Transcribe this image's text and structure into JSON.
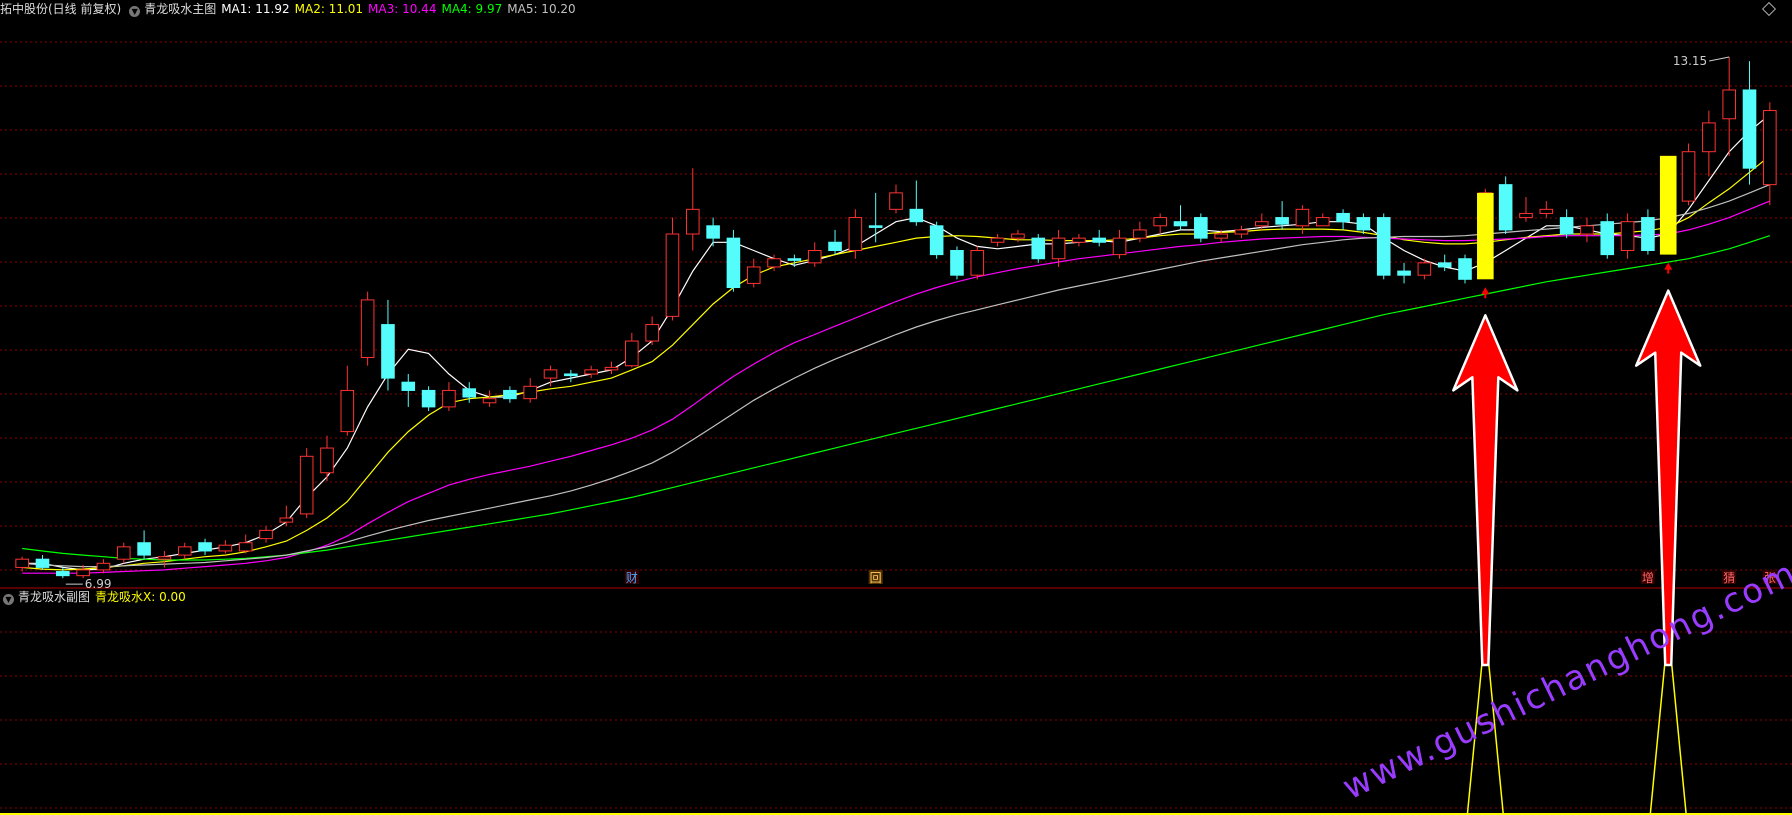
{
  "header": {
    "stock": "拓中股份(日线 前复权)",
    "indicator": "青龙吸水主图",
    "ma": [
      {
        "label": "MA1: 11.92",
        "color": "#ffffff"
      },
      {
        "label": "MA2: 11.01",
        "color": "#ffff00"
      },
      {
        "label": "MA3: 10.44",
        "color": "#ff00ff"
      },
      {
        "label": "MA4: 9.97",
        "color": "#00ff00"
      },
      {
        "label": "MA5: 10.20",
        "color": "#c0c0c0"
      }
    ]
  },
  "sub_header": {
    "indicator": "青龙吸水副图",
    "value_label": "青龙吸水X: 0.00"
  },
  "markers": [
    "财",
    "回",
    "增",
    "猜",
    "张"
  ],
  "watermark": "www.gushichanghong.com",
  "colors": {
    "up": "#ff3232",
    "down": "#54fcfc",
    "signal": "#ffff00",
    "grid": "#8a0000",
    "arrow": "#ff0000"
  },
  "chart_data": {
    "type": "candlestick",
    "y_max_label": "13.15",
    "y_min_label": "6.99",
    "ylim": [
      6.7,
      13.6
    ],
    "candles": [
      [
        6.95,
        7.05,
        7.08,
        6.9
      ],
      [
        7.05,
        6.95,
        7.1,
        6.92
      ],
      [
        6.9,
        6.85,
        6.95,
        6.82
      ],
      [
        6.85,
        6.92,
        6.98,
        6.82
      ],
      [
        6.92,
        7.0,
        7.05,
        6.88
      ],
      [
        7.05,
        7.2,
        7.25,
        7.0
      ],
      [
        7.25,
        7.1,
        7.4,
        7.05
      ],
      [
        7.05,
        7.08,
        7.15,
        6.95
      ],
      [
        7.1,
        7.2,
        7.25,
        7.05
      ],
      [
        7.25,
        7.15,
        7.3,
        7.1
      ],
      [
        7.15,
        7.22,
        7.28,
        7.12
      ],
      [
        7.15,
        7.25,
        7.35,
        7.12
      ],
      [
        7.3,
        7.4,
        7.45,
        7.25
      ],
      [
        7.5,
        7.55,
        7.7,
        7.45
      ],
      [
        7.6,
        8.3,
        8.4,
        7.55
      ],
      [
        8.1,
        8.4,
        8.55,
        8.0
      ],
      [
        8.6,
        9.1,
        9.4,
        8.55
      ],
      [
        9.5,
        10.2,
        10.3,
        9.4
      ],
      [
        9.9,
        9.25,
        10.2,
        9.1
      ],
      [
        9.2,
        9.1,
        9.3,
        8.9
      ],
      [
        9.1,
        8.9,
        9.15,
        8.85
      ],
      [
        8.9,
        9.1,
        9.2,
        8.85
      ],
      [
        9.12,
        9.02,
        9.2,
        8.95
      ],
      [
        8.95,
        9.0,
        9.1,
        8.9
      ],
      [
        9.1,
        9.0,
        9.15,
        8.95
      ],
      [
        9.0,
        9.15,
        9.25,
        8.95
      ],
      [
        9.25,
        9.35,
        9.4,
        9.15
      ],
      [
        9.3,
        9.28,
        9.35,
        9.2
      ],
      [
        9.3,
        9.35,
        9.4,
        9.25
      ],
      [
        9.35,
        9.38,
        9.45,
        9.3
      ],
      [
        9.4,
        9.7,
        9.8,
        9.38
      ],
      [
        9.7,
        9.9,
        10.0,
        9.65
      ],
      [
        10.0,
        11.0,
        11.2,
        9.95
      ],
      [
        11.0,
        11.3,
        11.8,
        10.8
      ],
      [
        11.1,
        10.95,
        11.2,
        10.85
      ],
      [
        10.95,
        10.35,
        11.05,
        10.3
      ],
      [
        10.4,
        10.6,
        10.7,
        10.35
      ],
      [
        10.6,
        10.7,
        10.75,
        10.55
      ],
      [
        10.7,
        10.68,
        10.75,
        10.6
      ],
      [
        10.65,
        10.8,
        10.9,
        10.6
      ],
      [
        10.9,
        10.8,
        11.05,
        10.75
      ],
      [
        10.8,
        11.2,
        11.3,
        10.7
      ],
      [
        11.1,
        11.08,
        11.5,
        10.9
      ],
      [
        11.3,
        11.5,
        11.6,
        11.25
      ],
      [
        11.3,
        11.15,
        11.65,
        11.1
      ],
      [
        11.1,
        10.75,
        11.15,
        10.7
      ],
      [
        10.8,
        10.5,
        10.85,
        10.45
      ],
      [
        10.5,
        10.8,
        10.85,
        10.45
      ],
      [
        10.9,
        10.95,
        11.0,
        10.85
      ],
      [
        10.95,
        11.0,
        11.05,
        10.9
      ],
      [
        10.95,
        10.7,
        11.0,
        10.65
      ],
      [
        10.7,
        10.95,
        11.05,
        10.6
      ],
      [
        10.9,
        10.95,
        11.0,
        10.85
      ],
      [
        10.95,
        10.9,
        11.05,
        10.85
      ],
      [
        10.75,
        10.95,
        11.05,
        10.7
      ],
      [
        10.95,
        11.05,
        11.15,
        10.9
      ],
      [
        11.1,
        11.2,
        11.25,
        11.0
      ],
      [
        11.15,
        11.1,
        11.35,
        11.05
      ],
      [
        11.2,
        10.95,
        11.25,
        10.9
      ],
      [
        10.95,
        11.0,
        11.05,
        10.9
      ],
      [
        11.0,
        11.05,
        11.1,
        10.95
      ],
      [
        11.1,
        11.15,
        11.25,
        11.05
      ],
      [
        11.2,
        11.12,
        11.4,
        11.05
      ],
      [
        11.1,
        11.3,
        11.35,
        11.0
      ],
      [
        11.1,
        11.2,
        11.25,
        11.1
      ],
      [
        11.25,
        11.15,
        11.3,
        11.05
      ],
      [
        11.2,
        11.05,
        11.25,
        11.0
      ],
      [
        11.2,
        10.5,
        11.25,
        10.45
      ],
      [
        10.55,
        10.5,
        10.65,
        10.4
      ],
      [
        10.5,
        10.65,
        10.7,
        10.45
      ],
      [
        10.65,
        10.6,
        10.75,
        10.55
      ],
      [
        10.7,
        10.45,
        10.75,
        10.4
      ],
      [
        10.5,
        11.5,
        11.55,
        10.45
      ],
      [
        11.6,
        11.05,
        11.7,
        11.0
      ],
      [
        11.2,
        11.25,
        11.45,
        11.15
      ],
      [
        11.25,
        11.3,
        11.4,
        11.2
      ],
      [
        11.2,
        11.0,
        11.3,
        10.95
      ],
      [
        11.0,
        11.1,
        11.2,
        10.9
      ],
      [
        11.15,
        10.75,
        11.25,
        10.7
      ],
      [
        10.8,
        11.15,
        11.25,
        10.7
      ],
      [
        11.2,
        10.8,
        11.3,
        10.75
      ],
      [
        10.8,
        11.25,
        11.4,
        10.75
      ],
      [
        11.4,
        12.0,
        12.1,
        11.35
      ],
      [
        12.0,
        12.35,
        12.5,
        11.7
      ],
      [
        12.4,
        12.75,
        13.15,
        11.95
      ],
      [
        12.75,
        11.8,
        13.1,
        11.6
      ],
      [
        11.6,
        12.5,
        12.6,
        11.35
      ]
    ],
    "ma_series": [
      {
        "label": "MA1",
        "color": "#ffffff",
        "values": [
          7.0,
          7.0,
          6.95,
          6.92,
          6.93,
          7.0,
          7.05,
          7.08,
          7.12,
          7.16,
          7.2,
          7.25,
          7.35,
          7.5,
          7.8,
          8.05,
          8.4,
          8.9,
          9.3,
          9.6,
          9.55,
          9.3,
          9.1,
          9.02,
          9.02,
          9.1,
          9.2,
          9.25,
          9.3,
          9.35,
          9.5,
          9.7,
          10.1,
          10.55,
          10.9,
          10.9,
          10.8,
          10.7,
          10.62,
          10.68,
          10.75,
          10.85,
          11.0,
          11.15,
          11.2,
          11.1,
          10.95,
          10.85,
          10.82,
          10.85,
          10.88,
          10.88,
          10.9,
          10.92,
          10.9,
          10.95,
          11.0,
          11.05,
          11.05,
          11.03,
          11.05,
          11.08,
          11.1,
          11.12,
          11.15,
          11.15,
          11.12,
          10.95,
          10.8,
          10.68,
          10.6,
          10.55,
          10.65,
          10.8,
          10.95,
          11.1,
          11.1,
          11.05,
          11.0,
          10.98,
          10.95,
          11.0,
          11.3,
          11.65,
          12.0,
          12.25,
          12.45
        ]
      },
      {
        "label": "MA2",
        "color": "#ffff00",
        "values": [
          6.95,
          6.93,
          6.92,
          6.93,
          6.95,
          6.97,
          7.0,
          7.02,
          7.05,
          7.08,
          7.1,
          7.14,
          7.2,
          7.27,
          7.4,
          7.55,
          7.75,
          8.05,
          8.35,
          8.6,
          8.8,
          8.95,
          9.0,
          9.02,
          9.05,
          9.08,
          9.12,
          9.15,
          9.2,
          9.25,
          9.35,
          9.45,
          9.65,
          9.9,
          10.15,
          10.35,
          10.5,
          10.6,
          10.65,
          10.7,
          10.75,
          10.8,
          10.85,
          10.9,
          10.95,
          10.97,
          10.98,
          10.97,
          10.95,
          10.93,
          10.93,
          10.92,
          10.92,
          10.92,
          10.93,
          10.95,
          10.98,
          11.0,
          11.0,
          11.02,
          11.03,
          11.05,
          11.06,
          11.06,
          11.06,
          11.05,
          11.02,
          10.98,
          10.93,
          10.9,
          10.88,
          10.88,
          10.9,
          10.93,
          10.96,
          10.98,
          11.0,
          11.0,
          11.0,
          11.02,
          11.04,
          11.08,
          11.2,
          11.38,
          11.55,
          11.75,
          11.95
        ]
      },
      {
        "label": "MA3",
        "color": "#ff00ff",
        "values": [
          6.88,
          6.88,
          6.88,
          6.88,
          6.89,
          6.9,
          6.91,
          6.92,
          6.94,
          6.96,
          6.98,
          7.0,
          7.03,
          7.07,
          7.14,
          7.22,
          7.33,
          7.48,
          7.62,
          7.75,
          7.85,
          7.95,
          8.02,
          8.08,
          8.13,
          8.18,
          8.24,
          8.3,
          8.37,
          8.44,
          8.52,
          8.62,
          8.75,
          8.92,
          9.1,
          9.27,
          9.42,
          9.56,
          9.68,
          9.78,
          9.88,
          9.98,
          10.08,
          10.18,
          10.27,
          10.35,
          10.42,
          10.48,
          10.53,
          10.58,
          10.62,
          10.66,
          10.7,
          10.73,
          10.76,
          10.79,
          10.82,
          10.85,
          10.87,
          10.9,
          10.92,
          10.94,
          10.95,
          10.96,
          10.97,
          10.97,
          10.96,
          10.95,
          10.94,
          10.93,
          10.92,
          10.92,
          10.93,
          10.94,
          10.95,
          10.97,
          10.98,
          10.98,
          10.98,
          10.98,
          10.99,
          11.0,
          11.05,
          11.12,
          11.2,
          11.3,
          11.4
        ]
      },
      {
        "label": "MA4",
        "color": "#00ff00",
        "values": [
          7.18,
          7.15,
          7.12,
          7.1,
          7.08,
          7.06,
          7.05,
          7.04,
          7.04,
          7.04,
          7.05,
          7.06,
          7.08,
          7.1,
          7.13,
          7.16,
          7.2,
          7.24,
          7.28,
          7.32,
          7.36,
          7.4,
          7.44,
          7.48,
          7.52,
          7.56,
          7.6,
          7.65,
          7.7,
          7.75,
          7.8,
          7.86,
          7.92,
          7.98,
          8.04,
          8.1,
          8.16,
          8.22,
          8.28,
          8.34,
          8.4,
          8.46,
          8.52,
          8.58,
          8.64,
          8.7,
          8.76,
          8.82,
          8.88,
          8.94,
          9.0,
          9.06,
          9.12,
          9.18,
          9.24,
          9.3,
          9.36,
          9.42,
          9.48,
          9.54,
          9.6,
          9.66,
          9.72,
          9.78,
          9.84,
          9.9,
          9.96,
          10.02,
          10.07,
          10.12,
          10.17,
          10.22,
          10.27,
          10.32,
          10.37,
          10.42,
          10.46,
          10.5,
          10.54,
          10.58,
          10.62,
          10.66,
          10.7,
          10.76,
          10.82,
          10.9,
          10.98
        ]
      },
      {
        "label": "MA5",
        "color": "#c0c0c0",
        "values": [
          7.0,
          6.98,
          6.97,
          6.96,
          6.96,
          6.97,
          6.98,
          6.99,
          7.0,
          7.01,
          7.03,
          7.05,
          7.07,
          7.1,
          7.15,
          7.2,
          7.26,
          7.33,
          7.4,
          7.46,
          7.52,
          7.57,
          7.62,
          7.67,
          7.72,
          7.77,
          7.82,
          7.88,
          7.95,
          8.03,
          8.12,
          8.22,
          8.35,
          8.5,
          8.66,
          8.82,
          8.98,
          9.12,
          9.25,
          9.37,
          9.48,
          9.58,
          9.68,
          9.78,
          9.87,
          9.95,
          10.02,
          10.08,
          10.14,
          10.2,
          10.26,
          10.32,
          10.37,
          10.42,
          10.47,
          10.52,
          10.57,
          10.62,
          10.67,
          10.71,
          10.75,
          10.79,
          10.83,
          10.87,
          10.9,
          10.93,
          10.95,
          10.96,
          10.97,
          10.97,
          10.97,
          10.98,
          11.0,
          11.02,
          11.04,
          11.06,
          11.08,
          11.1,
          11.12,
          11.14,
          11.16,
          11.2,
          11.25,
          11.32,
          11.4,
          11.5,
          11.6
        ]
      }
    ],
    "signals": [
      {
        "index": 72,
        "bottom": 10.45,
        "top": 11.5
      },
      {
        "index": 81,
        "bottom": 10.75,
        "top": 11.95
      }
    ],
    "sub_chart": {
      "value": 0.0
    }
  }
}
